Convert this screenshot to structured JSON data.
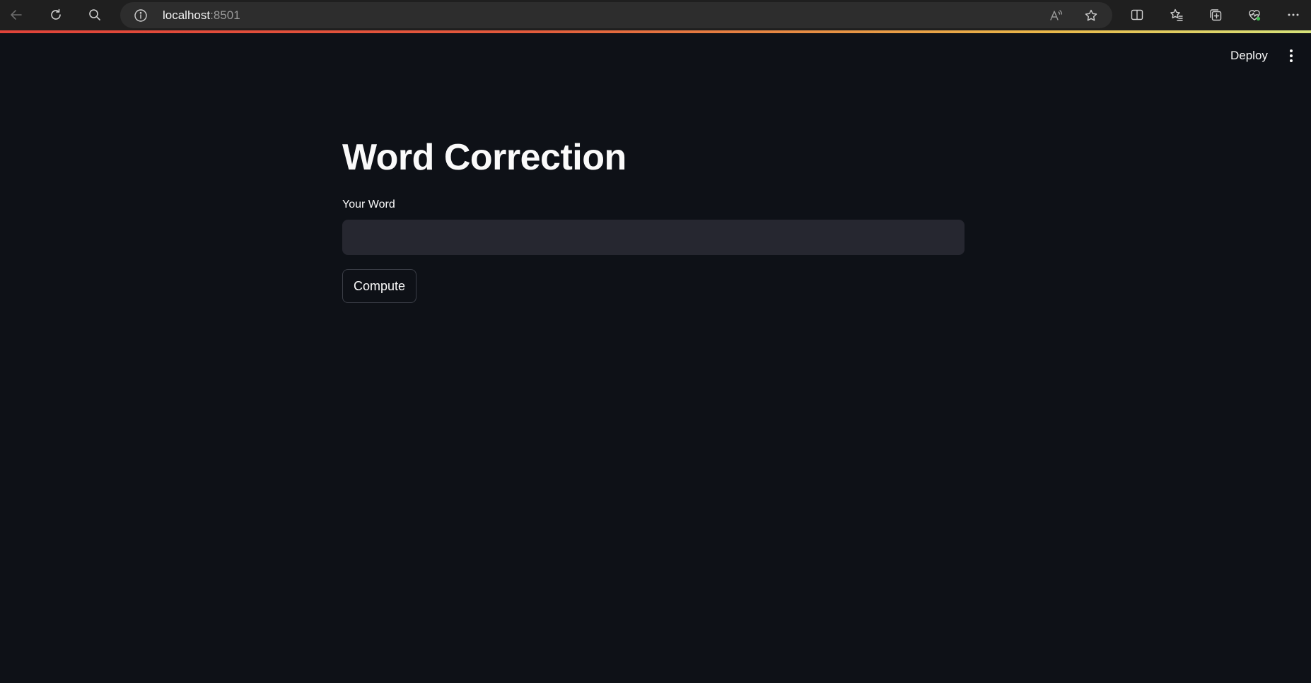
{
  "browser": {
    "url_host": "localhost",
    "url_port": ":8501",
    "icons": {
      "back": "back-arrow-icon",
      "reload": "reload-icon",
      "search": "search-icon",
      "site_info": "info-icon",
      "read_aloud": "read-aloud-icon",
      "favorite": "star-icon",
      "split_screen": "split-screen-icon",
      "favorites": "favorites-icon",
      "collections": "collections-icon",
      "health": "browser-essentials-icon",
      "menu": "more-horizontal-icon"
    },
    "progress_colors": [
      "#e0433a",
      "#e9b84a",
      "#d6e37a"
    ]
  },
  "app": {
    "background": "#0e1117",
    "header": {
      "deploy_label": "Deploy",
      "menu_icon": "more-vertical-icon"
    },
    "title": "Word Correction",
    "word_input": {
      "label": "Your Word",
      "value": "",
      "placeholder": ""
    },
    "compute_label": "Compute"
  }
}
